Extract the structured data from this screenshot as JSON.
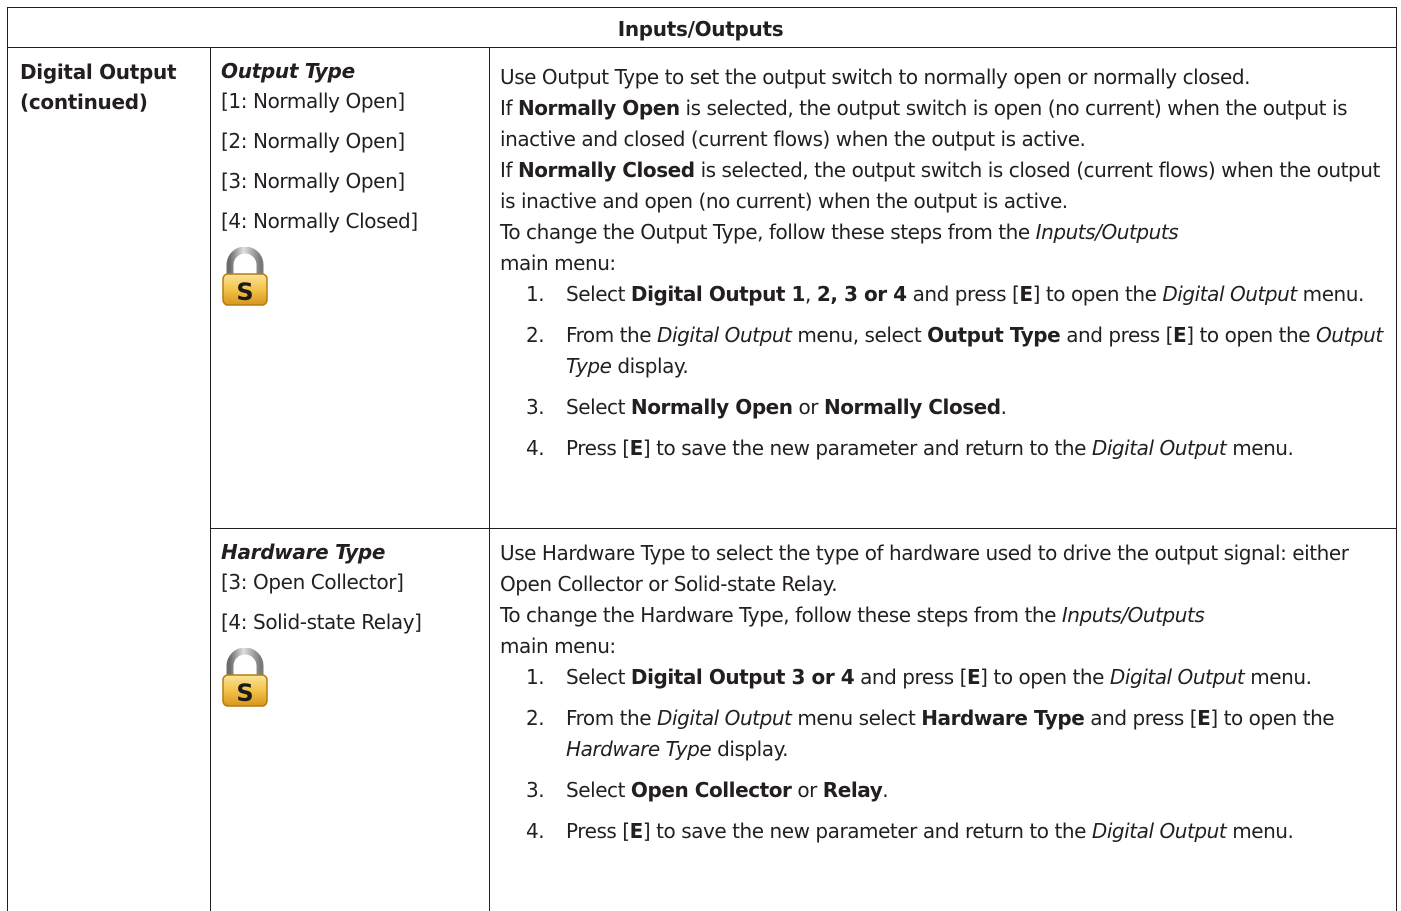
{
  "table": {
    "header": "Inputs/Outputs",
    "section": {
      "line1": "Digital Output",
      "line2": "(continued)"
    },
    "rows": [
      {
        "param_name": "Output Type",
        "options": [
          "[1: Normally Open]",
          "[2: Normally Open]",
          "[3: Normally Open]",
          "[4: Normally Closed]"
        ],
        "lock_icon": "security-lock-s-icon",
        "lock_letter": "S",
        "desc": {
          "p1": "Use Output Type to set the output switch to normally open or normally closed.",
          "p2_pre": "If ",
          "p2_bold": "Normally Open",
          "p2_post": " is selected, the output switch is open (no current) when the output is inactive and closed (current flows) when the output is active.",
          "p3_pre": "If ",
          "p3_bold": "Normally Closed",
          "p3_post": " is selected, the output switch is closed (current flows) when the output is inactive and open (no current) when the output is active.",
          "p4_pre": "To change the Output Type, follow these steps from the ",
          "p4_ital": "Inputs/Outputs",
          "p4_post": " main menu:",
          "steps": [
            {
              "num": "1.",
              "t1": "Select ",
              "b1": "Digital Output 1",
              "t2": ", ",
              "b2": "2, 3 or 4",
              "t3": " and press [",
              "k1": "E",
              "t4": "] to open the ",
              "i1": "Digital Output",
              "t5": " menu."
            },
            {
              "num": "2.",
              "t1": "From the ",
              "i1": "Digital Output",
              "t2": " menu, select ",
              "b1": "Output Type",
              "t3": " and press [",
              "k1": "E",
              "t4": "] to open the ",
              "i2": "Output Type",
              "t5": " display."
            },
            {
              "num": "3.",
              "t1": "Select ",
              "b1": "Normally Open",
              "t2": " or ",
              "b2": "Normally Closed",
              "t3": "."
            },
            {
              "num": "4.",
              "t1": "Press [",
              "k1": "E",
              "t2": "] to save the new parameter and return to the ",
              "i1": "Digital Output",
              "t3": " menu."
            }
          ]
        }
      },
      {
        "param_name": "Hardware Type",
        "options": [
          "[3: Open Collector]",
          "[4: Solid-state Relay]"
        ],
        "lock_icon": "security-lock-s-icon",
        "lock_letter": "S",
        "desc": {
          "p1": "Use Hardware Type to select the type of hardware used to drive the output signal: either Open Collector or Solid-state Relay.",
          "p4_pre": "To change the Hardware Type, follow these steps from the ",
          "p4_ital": "Inputs/Outputs",
          "p4_post": " main menu:",
          "steps": [
            {
              "num": "1.",
              "t1": "Select ",
              "b1": "Digital Output 3 or 4",
              "t2": " and press [",
              "k1": "E",
              "t3": "] to open the ",
              "i1": "Digital Output",
              "t4": " menu."
            },
            {
              "num": "2.",
              "t1": "From the ",
              "i1": "Digital Output",
              "t2": " menu select ",
              "b1": "Hardware Type",
              "t3": " and press [",
              "k1": "E",
              "t4": "] to open the ",
              "i2": "Hardware Type",
              "t5": " display."
            },
            {
              "num": "3.",
              "t1": "Select ",
              "b1": "Open Collector",
              "t2": " or ",
              "b2": "Relay",
              "t3": "."
            },
            {
              "num": "4.",
              "t1": "Press [",
              "k1": "E",
              "t2": "] to save the new parameter and return to the ",
              "i1": "Digital Output",
              "t3": " menu."
            }
          ]
        }
      }
    ]
  }
}
